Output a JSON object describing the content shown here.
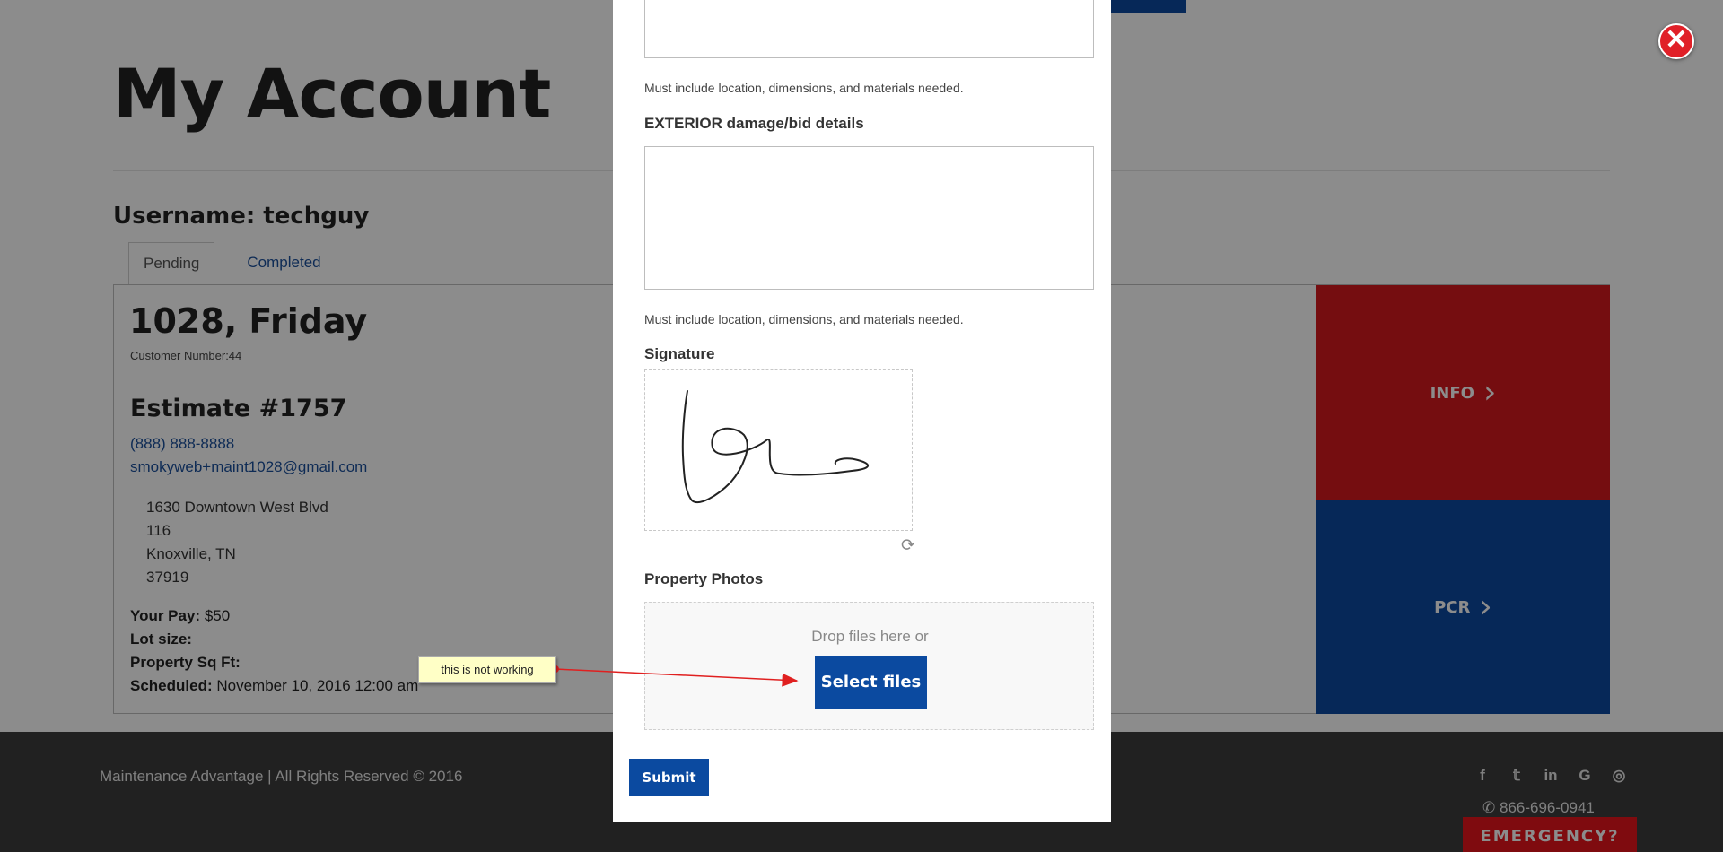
{
  "page": {
    "title": "My Account",
    "username": "Username: techguy",
    "tabs": [
      {
        "label": "Pending",
        "active": true
      },
      {
        "label": "Completed",
        "active": false
      }
    ],
    "job": {
      "title": "1028, Friday",
      "customer_number": "Customer Number:44",
      "estimate": "Estimate #1757",
      "phone": "(888) 888-8888",
      "email": "smokyweb+maint1028@gmail.com",
      "address": [
        "1630 Downtown West Blvd",
        "116",
        "Knoxville, TN",
        "37919"
      ],
      "pay_label": "Your Pay:",
      "pay_value": "$50",
      "lot_size_label": "Lot size:",
      "sqft_label": "Property Sq Ft:",
      "scheduled_label": "Scheduled:",
      "scheduled_value": "November 10, 2016 12:00 am"
    },
    "tiles": {
      "info": "INFO",
      "pcr": "PCR",
      "info_color": "#d6181e",
      "pcr_color": "#0b4aa0"
    },
    "footer": {
      "copyright": "Maintenance Advantage | All Rights Reserved © 2016",
      "phone": "866-696-0941",
      "emergency": "EMERGENCY?",
      "socials": [
        {
          "icon": "facebook-icon",
          "glyph": "f"
        },
        {
          "icon": "twitter-icon",
          "glyph": "𝕥"
        },
        {
          "icon": "linkedin-icon",
          "glyph": "in"
        },
        {
          "icon": "google-icon",
          "glyph": "G"
        },
        {
          "icon": "instagram-icon",
          "glyph": "◎"
        }
      ]
    }
  },
  "modal": {
    "interior_help": "Must include location, dimensions, and materials needed.",
    "exterior_label": "EXTERIOR damage/bid details",
    "exterior_help": "Must include location, dimensions, and materials needed.",
    "signature_label": "Signature",
    "photos_label": "Property Photos",
    "drop_text": "Drop files here or",
    "select_files": "Select files",
    "submit": "Submit",
    "close_glyph": "✕",
    "refresh_glyph": "⟳"
  },
  "annotation": {
    "text": "this is not working",
    "color": "#e02020"
  },
  "colors": {
    "brand_blue": "#0b4aa0",
    "brand_red": "#e8141c",
    "link": "#1a4f9c"
  }
}
